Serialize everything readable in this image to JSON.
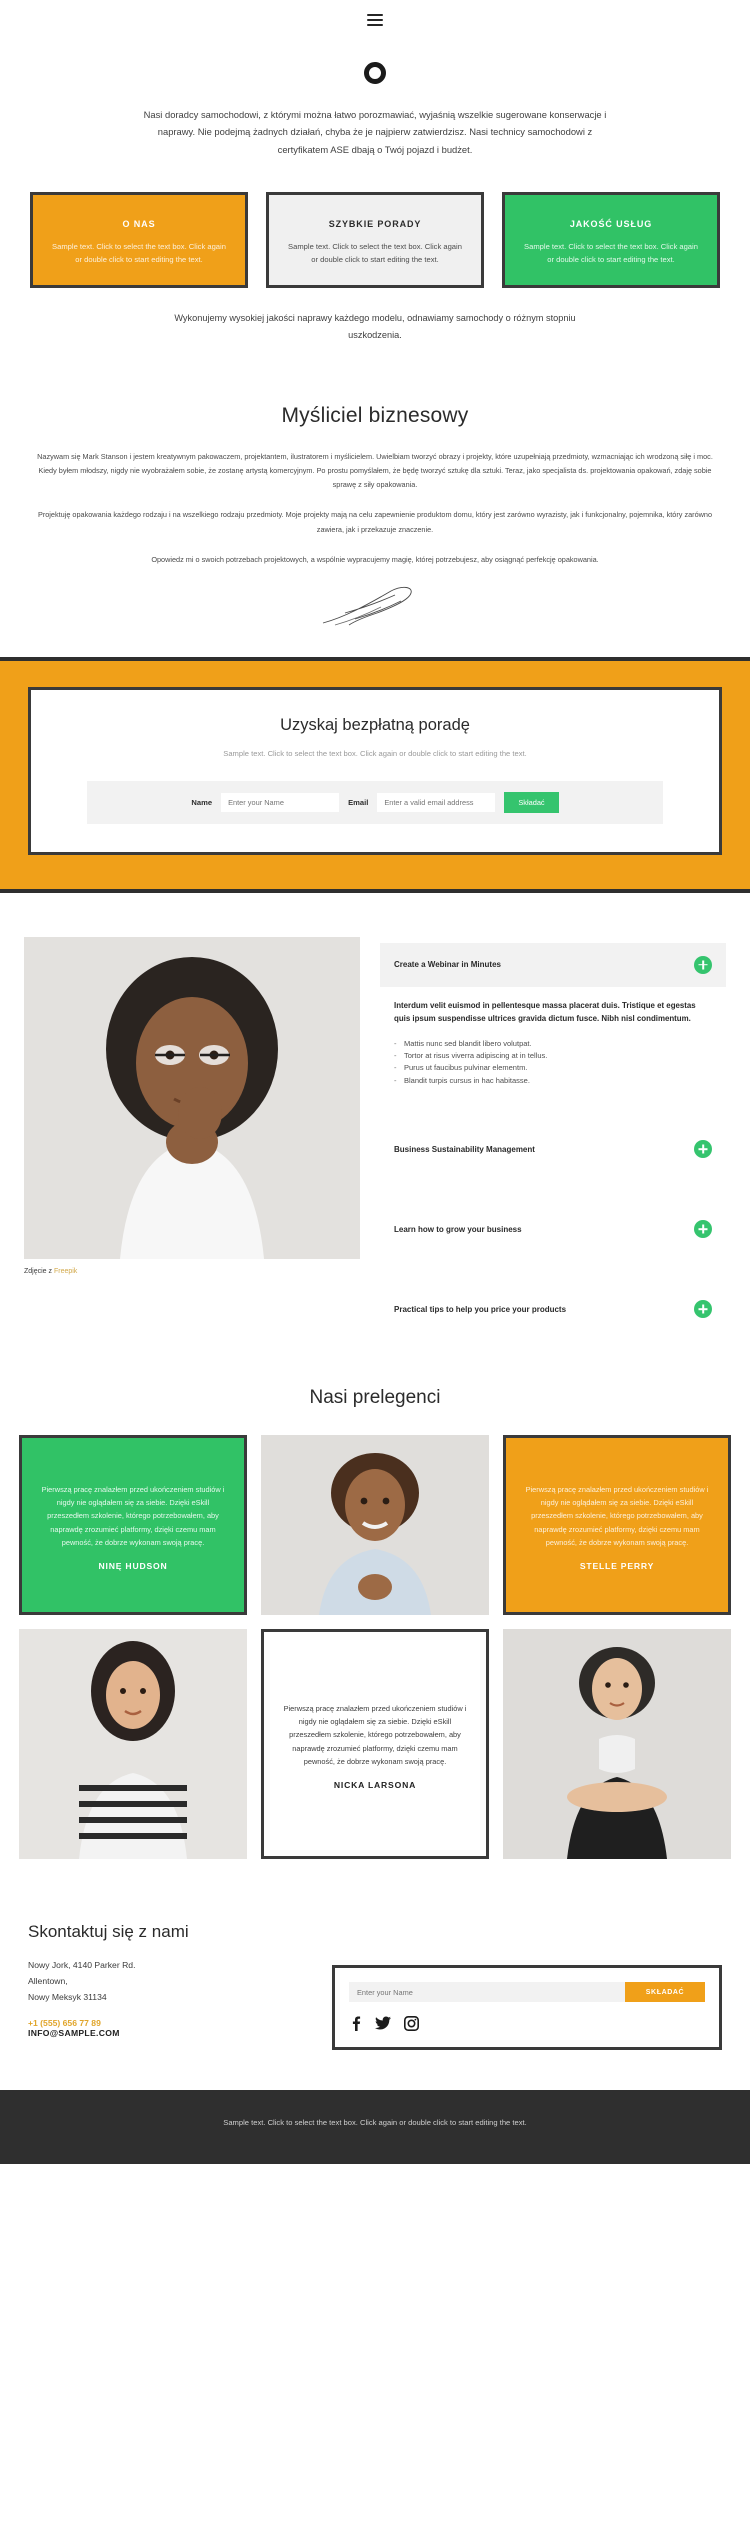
{
  "header": {
    "menu_icon": "hamburger-menu-icon"
  },
  "hero": {
    "logo_icon": "circle-logo-icon",
    "paragraph": "Nasi doradcy samochodowi, z którymi można łatwo porozmawiać, wyjaśnią wszelkie sugerowane konserwacje i naprawy. Nie podejmą żadnych działań, chyba że je najpierw zatwierdzisz. Nasi technicy samochodowi z certyfikatem ASE dbają o Twój pojazd i budżet."
  },
  "cards": [
    {
      "title": "O NAS",
      "body": "Sample text. Click to select the text box. Click again or double click to start editing the text.",
      "color": "#f0a019"
    },
    {
      "title": "SZYBKIE PORADY",
      "body": "Sample text. Click to select the text box. Click again or double click to start editing the text.",
      "color": "#f0f0f0"
    },
    {
      "title": "JAKOŚĆ USŁUG",
      "body": "Sample text. Click to select the text box. Click again or double click to start editing the text.",
      "color": "#31c266"
    }
  ],
  "cards_note": "Wykonujemy wysokiej jakości naprawy każdego modelu, odnawiamy samochody o różnym stopniu uszkodzenia.",
  "thinker": {
    "heading": "Myśliciel biznesowy",
    "p1": "Nazywam się Mark Stanson i jestem kreatywnym pakowaczem, projektantem, ilustratorem i myślicielem. Uwielbiam tworzyć obrazy i projekty, które uzupełniają przedmioty, wzmacniając ich wrodzoną siłę i moc. Kiedy byłem młodszy, nigdy nie wyobrażałem sobie, że zostanę artystą komercyjnym. Po prostu pomyślałem, że będę tworzyć sztukę dla sztuki. Teraz, jako specjalista ds. projektowania opakowań, zdaję sobie sprawę z siły opakowania.",
    "p2": "Projektuję opakowania każdego rodzaju i na wszelkiego rodzaju przedmioty. Moje projekty mają na celu zapewnienie produktom domu, który jest zarówno wyrazisty, jak i funkcjonalny, pojemnika, który zarówno zawiera, jak i przekazuje znaczenie.",
    "p3": "Opowiedz mi o swoich potrzebach projektowych, a wspólnie wypracujemy magię, której potrzebujesz, aby osiągnąć perfekcję opakowania.",
    "signature_icon": "signature-icon"
  },
  "advice_band": {
    "heading": "Uzyskaj bezpłatną poradę",
    "subtext": "Sample text. Click to select the text box. Click again or double click to start editing the text.",
    "name_label": "Name",
    "name_placeholder": "Enter your Name",
    "email_label": "Email",
    "email_placeholder": "Enter a valid email address",
    "submit_label": "Składać",
    "band_color": "#f0a019",
    "submit_color": "#35c46e"
  },
  "webinar": {
    "photo_alt": "woman-thinking-photo",
    "credit_prefix": "Zdjęcie z ",
    "credit_link": "Freepik",
    "accordion": [
      {
        "title": "Create a Webinar in Minutes",
        "open": true,
        "lead": "Interdum velit euismod in pellentesque massa placerat duis. Tristique et egestas quis ipsum suspendisse ultrices gravida dictum fusce. Nibh nisl condimentum.",
        "items": [
          "Mattis nunc sed blandit libero volutpat.",
          "Tortor at risus viverra adipiscing at in tellus.",
          "Purus ut faucibus pulvinar elementm.",
          "Blandit turpis cursus in hac habitasse."
        ]
      },
      {
        "title": "Business Sustainability Management",
        "open": false
      },
      {
        "title": "Learn how to grow your business",
        "open": false
      },
      {
        "title": "Practical tips to help you price your products",
        "open": false
      }
    ],
    "plus_icon": "plus-circle-icon"
  },
  "speakers": {
    "heading": "Nasi prelegenci",
    "quote_text": "Pierwszą pracę znalazłem przed ukończeniem studiów i nigdy nie oglądałem się za siebie. Dzięki eSkill przeszedłem szkolenie, którego potrzebowałem, aby naprawdę zrozumieć platformy, dzięki czemu mam pewność, że dobrze wykonam swoją pracę.",
    "cells": [
      {
        "kind": "quote",
        "style": "green",
        "name": "NINĘ HUDSON"
      },
      {
        "kind": "photo",
        "alt": "man-smiling-photo"
      },
      {
        "kind": "quote",
        "style": "orange",
        "name": "STELLE PERRY"
      },
      {
        "kind": "photo",
        "alt": "woman-striped-shirt-photo"
      },
      {
        "kind": "quote",
        "style": "white",
        "name": "NICKA LARSONA"
      },
      {
        "kind": "photo",
        "alt": "woman-arms-crossed-photo"
      }
    ]
  },
  "contact": {
    "heading": "Skontaktuj się z nami",
    "address": [
      "Nowy Jork, 4140 Parker Rd.",
      "Allentown,",
      "Nowy Meksyk 31134"
    ],
    "phone": "+1 (555) 656 77 89",
    "email": "INFO@SAMPLE.COM",
    "phone_color": "#e0a52b",
    "subscribe_placeholder": "Enter your Name",
    "subscribe_label": "SKŁADAĆ",
    "socials": [
      {
        "name": "facebook-icon"
      },
      {
        "name": "twitter-icon"
      },
      {
        "name": "instagram-icon"
      }
    ]
  },
  "footer": {
    "text": "Sample text. Click to select the text box. Click again or double click to start editing the text."
  }
}
